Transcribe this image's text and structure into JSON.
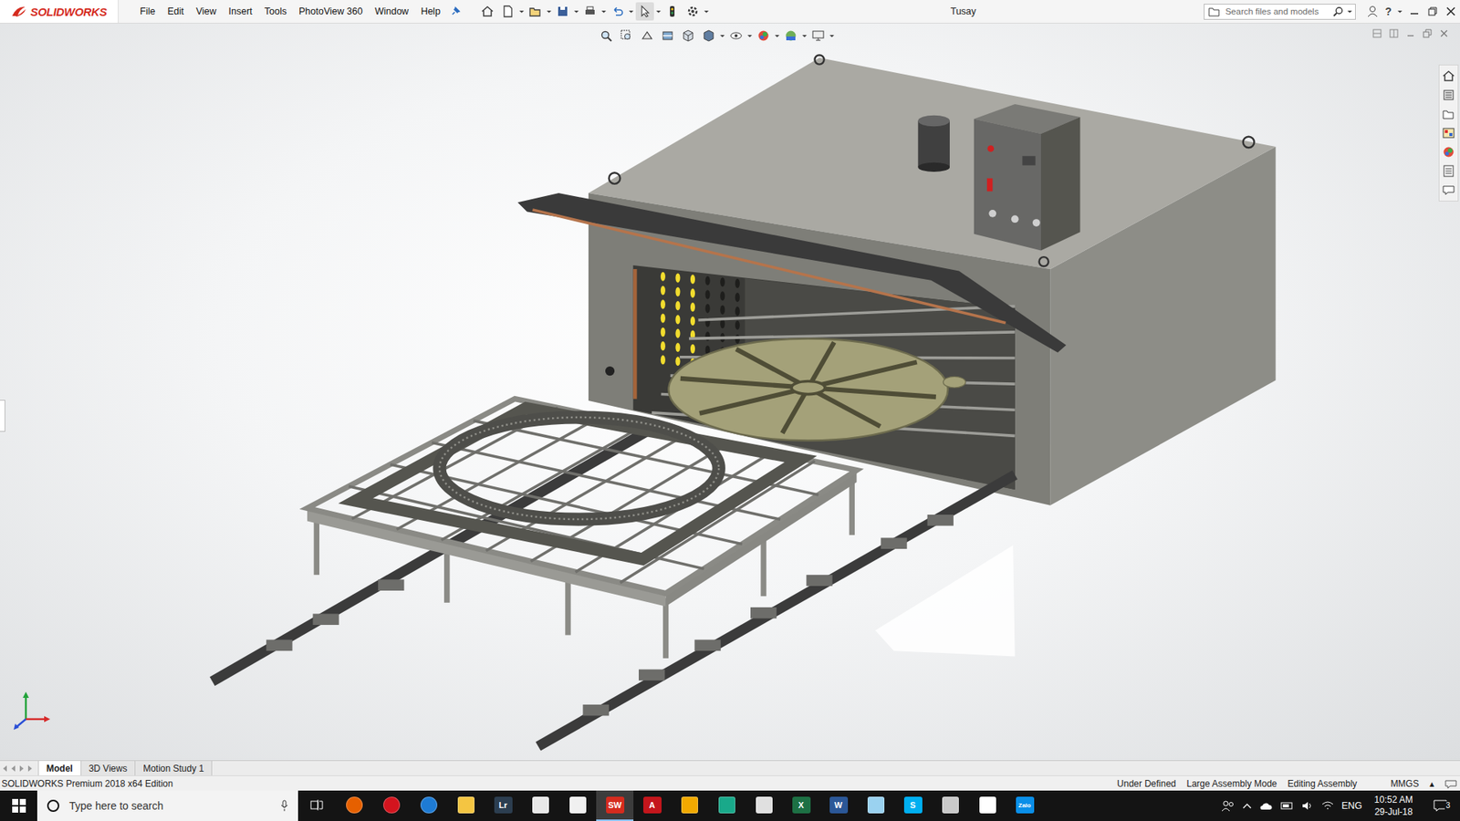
{
  "app": {
    "logo": "SOLIDWORKS",
    "menu": [
      "File",
      "Edit",
      "View",
      "Insert",
      "Tools",
      "PhotoView 360",
      "Window",
      "Help"
    ],
    "title": "Tusay",
    "search": {
      "placeholder": "Search files and models"
    },
    "help": "?"
  },
  "tabs": [
    {
      "label": "Model",
      "selected": true
    },
    {
      "label": "3D Views",
      "selected": false
    },
    {
      "label": "Motion Study 1",
      "selected": false
    }
  ],
  "status_bar": {
    "edition": "SOLIDWORKS Premium 2018 x64 Edition",
    "items": [
      "Under Defined",
      "Large Assembly Mode",
      "Editing Assembly"
    ],
    "units": "MMGS",
    "units_arrow": "▴"
  },
  "taskbar": {
    "search": {
      "placeholder": "Type here to search"
    },
    "apps": [
      {
        "kind": "shape",
        "color": "#e66000",
        "selected": false
      },
      {
        "kind": "shape",
        "color": "#d3141e",
        "selected": false
      },
      {
        "kind": "shape",
        "color": "#1e7bd4",
        "selected": false
      },
      {
        "kind": "shape",
        "color": "#f4c542",
        "selected": false
      },
      {
        "kind": "letter",
        "glyph": "Lr",
        "color": "#2c3e50",
        "selected": false
      },
      {
        "kind": "shape",
        "color": "#e8e8e8",
        "selected": false
      },
      {
        "kind": "shape",
        "color": "#f0f0f0",
        "selected": false
      },
      {
        "kind": "letter",
        "glyph": "SW",
        "color": "#d52b1e",
        "selected": true
      },
      {
        "kind": "letter",
        "glyph": "A",
        "color": "#c4161c",
        "selected": false
      },
      {
        "kind": "shape",
        "color": "#f2a900",
        "selected": false
      },
      {
        "kind": "shape",
        "color": "#19a98a",
        "selected": false
      },
      {
        "kind": "shape",
        "color": "#e0e0e0",
        "selected": false
      },
      {
        "kind": "letter",
        "glyph": "X",
        "color": "#1d7044",
        "selected": false
      },
      {
        "kind": "letter",
        "glyph": "W",
        "color": "#2b5797",
        "selected": false
      },
      {
        "kind": "shape",
        "color": "#9ad2f0",
        "selected": false
      },
      {
        "kind": "letter",
        "glyph": "S",
        "color": "#00aff0",
        "selected": false
      },
      {
        "kind": "shape",
        "color": "#c9c9c9",
        "selected": false
      },
      {
        "kind": "shape",
        "color": "#ffffff",
        "selected": false
      },
      {
        "kind": "letter",
        "glyph": "Zalo",
        "color": "#0a8fe8",
        "selected": false
      }
    ],
    "language": "ENG",
    "time": "10:52 AM",
    "date": "29-Jul-18",
    "notifications": "3"
  }
}
